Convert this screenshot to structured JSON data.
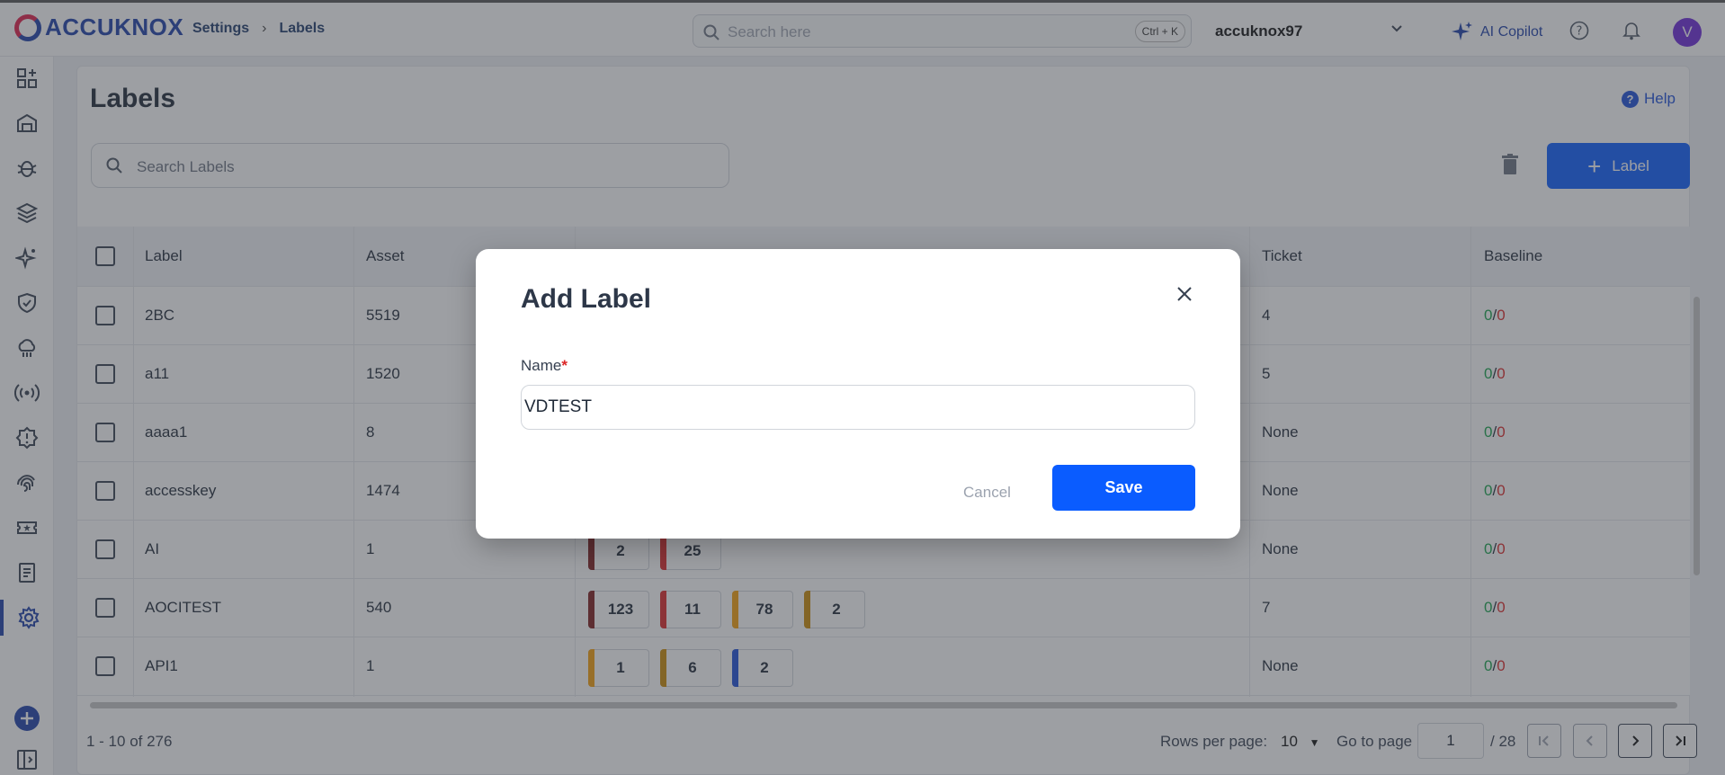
{
  "app": {
    "logo_text": "ACCUKNOX",
    "breadcrumb": [
      "Settings",
      "Labels"
    ],
    "search_placeholder": "Search here",
    "search_shortcut": "Ctrl + K",
    "tenant": "accuknox97",
    "copilot_label": "AI Copilot",
    "avatar_initial": "V"
  },
  "sidebar": {
    "icons": [
      "dashboard-icon",
      "inventory-icon",
      "bug-icon",
      "layers-icon",
      "sparkles-icon",
      "shield-icon",
      "cloud-icon",
      "broadcast-icon",
      "alert-icon",
      "fingerprint-icon",
      "ticket-icon",
      "report-icon",
      "settings-icon"
    ],
    "active": "settings-icon"
  },
  "page": {
    "title": "Labels",
    "help_label": "Help",
    "search_placeholder": "Search Labels",
    "add_button": "Label"
  },
  "table": {
    "headers": [
      "Label",
      "Asset",
      "",
      "Ticket",
      "Baseline"
    ],
    "rows": [
      {
        "label": "2BC",
        "asset": "5519",
        "ticket": "4",
        "baseline_a": "0",
        "baseline_b": "0",
        "badges": []
      },
      {
        "label": "a11",
        "asset": "1520",
        "ticket": "5",
        "baseline_a": "0",
        "baseline_b": "0",
        "badges": []
      },
      {
        "label": "aaaa1",
        "asset": "8",
        "ticket": "None",
        "baseline_a": "0",
        "baseline_b": "0",
        "badges": []
      },
      {
        "label": "accesskey",
        "asset": "1474",
        "ticket": "None",
        "baseline_a": "0",
        "baseline_b": "0",
        "badges": []
      },
      {
        "label": "AI",
        "asset": "1",
        "ticket": "None",
        "baseline_a": "0",
        "baseline_b": "0",
        "badges": [
          {
            "value": "2",
            "color": "#7f1d1d"
          },
          {
            "value": "25",
            "color": "#dc2626"
          }
        ]
      },
      {
        "label": "AOCITEST",
        "asset": "540",
        "ticket": "7",
        "baseline_a": "0",
        "baseline_b": "0",
        "badges": [
          {
            "value": "123",
            "color": "#7f1d1d"
          },
          {
            "value": "11",
            "color": "#dc2626"
          },
          {
            "value": "78",
            "color": "#f59e0b"
          },
          {
            "value": "2",
            "color": "#ca8a04"
          }
        ]
      },
      {
        "label": "API1",
        "asset": "1",
        "ticket": "None",
        "baseline_a": "0",
        "baseline_b": "0",
        "badges": [
          {
            "value": "1",
            "color": "#f59e0b"
          },
          {
            "value": "6",
            "color": "#ca8a04"
          },
          {
            "value": "2",
            "color": "#1d4ed8"
          }
        ]
      }
    ]
  },
  "footer": {
    "range": "1 - 10 of 276",
    "rows_per_page_label": "Rows per page:",
    "rows_per_page": "10",
    "go_to_page_label": "Go to page",
    "current_page": "1",
    "total_pages": "/ 28"
  },
  "modal": {
    "title": "Add Label",
    "name_label": "Name",
    "required_mark": "*",
    "name_value": "VDTEST",
    "cancel": "Cancel",
    "save": "Save"
  },
  "colors": {
    "primary": "#0a5cff",
    "brand": "#1d3fa8",
    "baseline_pass": "#16a34a",
    "baseline_fail": "#dc2626"
  }
}
